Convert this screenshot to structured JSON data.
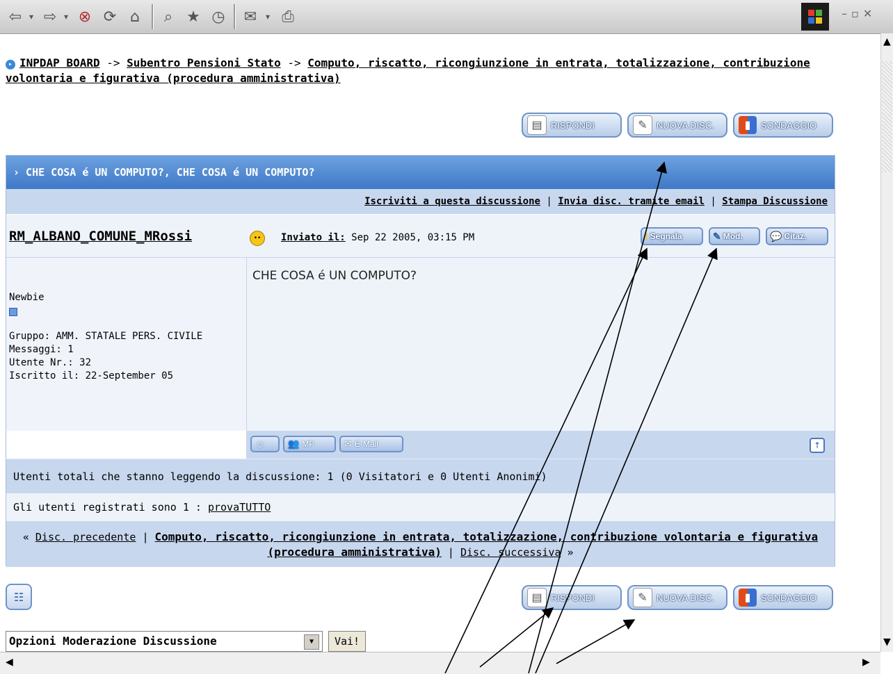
{
  "breadcrumb": {
    "home": "INPDAP BOARD",
    "sep1": "->",
    "forum": "Subentro Pensioni Stato",
    "sep2": "->",
    "topic": "Computo, riscatto, ricongiunzione in entrata, totalizzazione, contribuzione volontaria e figurativa (procedura amministrativa)"
  },
  "buttons": {
    "reply": "RISPONDI",
    "new_topic": "NUOVA DISC.",
    "poll": "SONDAGGIO"
  },
  "topic": {
    "title": "› CHE COSA é UN COMPUTO?, CHE COSA é UN COMPUTO?",
    "subscribe": "Iscriviti a questa discussione",
    "email": "Invia disc. tramite email",
    "print": "Stampa Discussione",
    "link_sep": "|"
  },
  "post": {
    "author": "RM_ALBANO_COMUNE_MRossi",
    "posted_label": "Inviato il:",
    "posted_date": "Sep 22 2005, 03:15 PM",
    "report": "Segnala",
    "edit": "Mod.",
    "quote": "Citaz.",
    "message": "CHE COSA é UN COMPUTO?",
    "rank": "Newbie",
    "group": "Gruppo: AMM. STATALE PERS. CIVILE",
    "messages": "Messaggi: 1",
    "user_no": "Utente Nr.: 32",
    "joined": "Iscritto il: 22-September 05",
    "pm": "MP",
    "email": "E-Mail"
  },
  "readers": "Utenti totali che stanno leggendo la discussione: 1 (0 Visitatori e 0 Utenti Anonimi)",
  "registered": {
    "label": "Gli utenti registrati sono 1 :",
    "user": "provaTUTTO"
  },
  "nav": {
    "prev_prefix": "«",
    "prev": "Disc. precedente",
    "sep": "|",
    "topic": "Computo, riscatto, ricongiunzione in entrata, totalizzazione, contribuzione volontaria e figurativa (procedura amministrativa)",
    "next": "Disc. successiva",
    "next_suffix": "»"
  },
  "moderation": {
    "select": "Opzioni Moderazione Discussione",
    "go": "Vai!"
  },
  "colors": {
    "header_blue": "#3e78c8",
    "light_blue": "#c7d7ee",
    "pale_blue": "#eef3fa"
  }
}
